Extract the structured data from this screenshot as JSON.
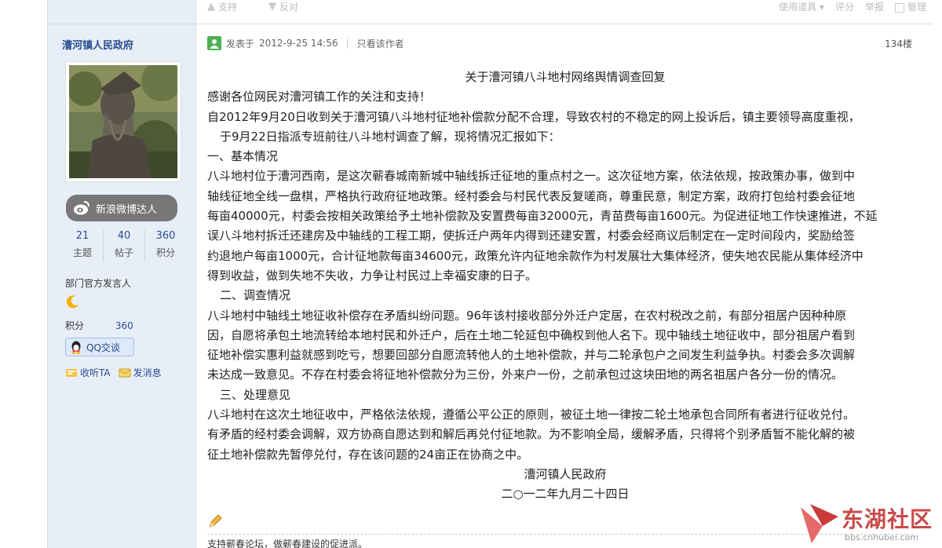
{
  "topbar": {
    "support": "支持",
    "oppose": "反对",
    "use_tool": "使用道具",
    "rate": "评分",
    "report": "举报",
    "manage": "管理"
  },
  "author": {
    "name": "漕河镇人民政府",
    "badge": "新浪微博达人",
    "stats": [
      {
        "value": "21",
        "label": "主题"
      },
      {
        "value": "40",
        "label": "帖子"
      },
      {
        "value": "360",
        "label": "积分"
      }
    ],
    "role": "部门官方发言人",
    "points_label": "积分",
    "points_value": "360",
    "qq_label": "QQ交谈",
    "follow_label": "收听TA",
    "message_label": "发消息"
  },
  "post": {
    "posted_prefix": "发表于",
    "posted_time": "2012-9-25 14:56",
    "only_author": "只看该作者",
    "floor": "134楼",
    "title": "关于漕河镇八斗地村网络舆情调查回复",
    "lines": [
      "感谢各位网民对漕河镇工作的关注和支持！",
      "自2012年9月20日收到关于漕河镇八斗地村征地补偿款分配不合理，导致农村的不稳定的网上投诉后，镇主要领导高度重视，",
      "于9月22日指派专班前往八斗地村调查了解，现将情况汇报如下：",
      "一、基本情况",
      "八斗地村位于漕河西南，是这次蕲春城南新城中轴线拆迁征地的重点村之一。这次征地方案，依法依规，按政策办事，做到中",
      "轴线征地全线一盘棋，严格执行政府征地政策。经村委会与村民代表反复嗟商，尊重民意，制定方案，政府打包给村委会征地",
      "每亩40000元，村委会按相关政策给予土地补偿款及安置费每亩32000元，青苗费每亩1600元。为促进征地工作快速推进，不延",
      "误八斗地村拆迁还建房及中轴线的工程工期，使拆迁户两年内得到还建安置，村委会经商议后制定在一定时间段内，奖励给签",
      "约退地户每亩1000元，合计征地款每亩34600元，政策允许内征地余款作为村发展壮大集体经济，使失地农民能从集体经济中",
      "得到收益，做到失地不失收，力争让村民过上幸福安康的日子。",
      "二、调查情况",
      "八斗地村中轴线土地征收补偿存在矛盾纠纷问题。96年该村接收部分外迁户定居，在农村税改之前，有部分祖居户因种种原",
      "因，自愿将承包土地流转给本地村民和外迁户，后在土地二轮延包中确权到他人名下。现中轴线土地征收中，部分祖居户看到",
      "征地补偿实惠利益就感到吃亏，想要回部分自愿流转他人的土地补偿款，并与二轮承包户之间发生利益争执。村委会多次调解",
      "未达成一致意见。不存在村委会将征地补偿款分为三份，外来户一份，之前承包过这块田地的两名祖居户各分一份的情况。",
      "三、处理意见",
      "八斗地村在这次土地征收中，严格依法依规，遵循公平公正的原则，被征土地一律按二轮土地承包合同所有者进行征收兑付。",
      "有矛盾的经村委会调解，双方协商自愿达到和解后再兑付征地款。为不影响全局，缓解矛盾，只得将个别矛盾暂不能化解的被",
      "征土地补偿款先暂停兑付，存在该问题的24亩正在协商之中。"
    ],
    "sign_org": "漕河镇人民政府",
    "sign_date": "二○一二年九月二十四日",
    "signature": "支持蕲春论坛，做蕲春建设的促进派。"
  },
  "watermark": {
    "text": "东湖社区",
    "url": "bbs.cnhubei.com"
  }
}
